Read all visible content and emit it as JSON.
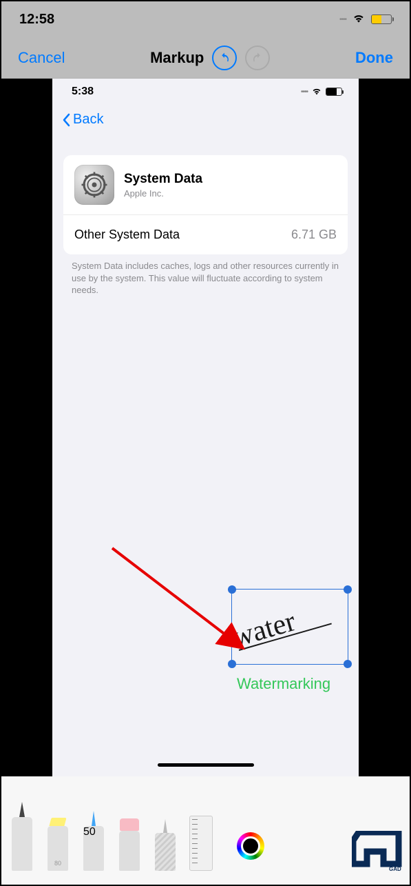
{
  "outer_status": {
    "time": "12:58"
  },
  "nav": {
    "cancel": "Cancel",
    "title": "Markup",
    "done": "Done"
  },
  "inner_status": {
    "time": "5:38"
  },
  "inner_nav": {
    "back": "Back"
  },
  "card": {
    "title": "System Data",
    "subtitle": "Apple Inc.",
    "row_label": "Other System Data",
    "row_value": "6.71 GB",
    "description": "System Data includes caches, logs and other resources currently in use by the system. This value will fluctuate according to system needs."
  },
  "signature": {
    "text": "water"
  },
  "annotation": {
    "label": "Watermarking"
  },
  "tools": {
    "highlighter_label": "80",
    "pencil_label": "50"
  },
  "corner_text": "GAD"
}
